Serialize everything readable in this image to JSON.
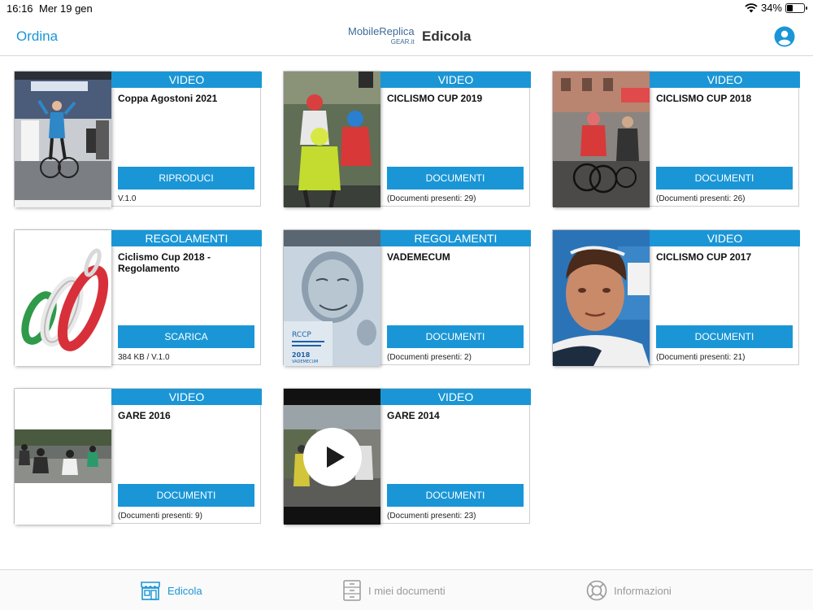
{
  "status": {
    "time": "16:16",
    "date": "Mer 19 gen",
    "battery": "34%",
    "battery_level": 0.34
  },
  "nav": {
    "left": "Ordina",
    "brand": "MobileReplica",
    "brand_sub": "GEAR.it",
    "title": "Edicola"
  },
  "cards": [
    {
      "category": "VIDEO",
      "title": "Coppa Agostoni 2021",
      "button": "RIPRODUCI",
      "meta": "V.1.0"
    },
    {
      "category": "VIDEO",
      "title": "CICLISMO CUP 2019",
      "button": "DOCUMENTI",
      "meta": "(Documenti presenti: 29)"
    },
    {
      "category": "VIDEO",
      "title": "CICLISMO CUP 2018",
      "button": "DOCUMENTI",
      "meta": "(Documenti presenti: 26)"
    },
    {
      "category": "REGOLAMENTI",
      "title": "Ciclismo Cup 2018 - Regolamento",
      "button": "SCARICA",
      "meta": "384 KB / V.1.0"
    },
    {
      "category": "REGOLAMENTI",
      "title": "VADEMECUM",
      "button": "DOCUMENTI",
      "meta": "(Documenti presenti: 2)"
    },
    {
      "category": "VIDEO",
      "title": "CICLISMO CUP 2017",
      "button": "DOCUMENTI",
      "meta": "(Documenti presenti: 21)"
    },
    {
      "category": "VIDEO",
      "title": "GARE 2016",
      "button": "DOCUMENTI",
      "meta": "(Documenti presenti: 9)"
    },
    {
      "category": "VIDEO",
      "title": "GARE 2014",
      "button": "DOCUMENTI",
      "meta": "(Documenti presenti: 23)"
    }
  ],
  "thumbnails": {
    "c4_text_1": "RCCP",
    "c4_text_2": "2018",
    "c4_text_3": "VADEMECUM"
  },
  "tabs": [
    {
      "label": "Edicola",
      "icon": "newsstand-icon",
      "active": true
    },
    {
      "label": "I miei documenti",
      "icon": "cabinet-icon",
      "active": false
    },
    {
      "label": "Informazioni",
      "icon": "lifebuoy-icon",
      "active": false
    }
  ],
  "colors": {
    "accent": "#1a96d6",
    "tab_inactive": "#9a9a9a"
  }
}
